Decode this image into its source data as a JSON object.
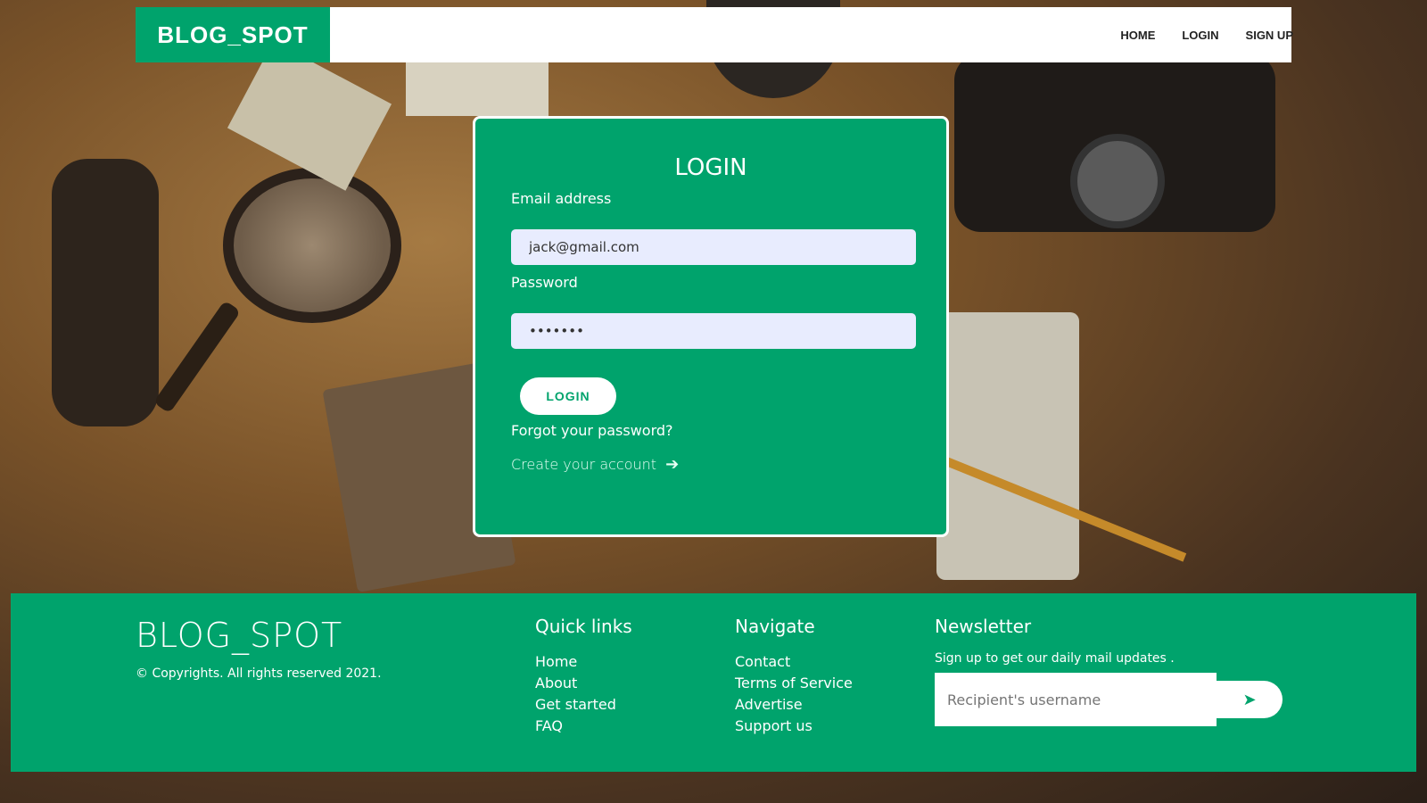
{
  "navbar": {
    "brand": "BLOG_SPOT",
    "links": [
      "HOME",
      "LOGIN",
      "SIGN UP"
    ]
  },
  "login": {
    "title": "LOGIN",
    "email_label": "Email address",
    "email_value": "jack@gmail.com",
    "password_label": "Password",
    "password_value": "•••••••",
    "button_label": "LOGIN",
    "forgot_text": "Forgot your password?",
    "create_text": "Create your account",
    "arrow_icon": "arrow-right-icon"
  },
  "footer": {
    "brand": "BLOG_SPOT",
    "copyright": "© Copyrights. All rights reserved 2021.",
    "quick_links": {
      "heading": "Quick links",
      "items": [
        "Home",
        "About",
        "Get started",
        "FAQ"
      ]
    },
    "navigate": {
      "heading": "Navigate",
      "items": [
        "Contact",
        "Terms of Service",
        "Advertise",
        "Support us"
      ]
    },
    "newsletter": {
      "heading": "Newsletter",
      "subtitle": "Sign up to get our daily mail updates .",
      "placeholder": "Recipient's username",
      "send_icon": "paper-plane-icon"
    }
  },
  "colors": {
    "accent": "#00a36c",
    "input_bg": "#e8ecfe"
  }
}
